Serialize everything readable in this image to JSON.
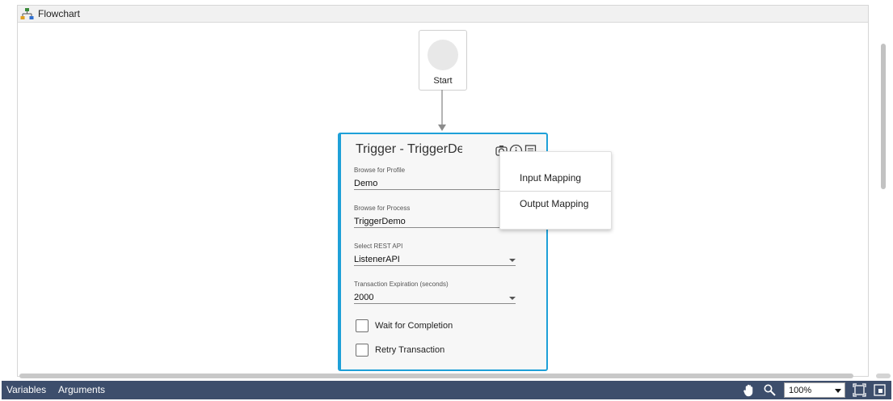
{
  "header": {
    "title": "Flowchart"
  },
  "start_node": {
    "label": "Start"
  },
  "trigger": {
    "title": "Trigger - TriggerDemo",
    "fields": [
      {
        "label": "Browse for Profile",
        "value": "Demo",
        "dropdown": false
      },
      {
        "label": "Browse for Process",
        "value": "TriggerDemo",
        "dropdown": false
      },
      {
        "label": "Select REST API",
        "value": "ListenerAPI",
        "dropdown": true
      },
      {
        "label": "Transaction Expiration (seconds)",
        "value": "2000",
        "dropdown": true
      }
    ],
    "checkboxes": [
      {
        "label": "Wait for Completion",
        "checked": false
      },
      {
        "label": "Retry Transaction",
        "checked": false
      }
    ],
    "icons": [
      "camera-icon",
      "info-icon",
      "notes-icon"
    ]
  },
  "context_menu": {
    "items": [
      "Input Mapping",
      "Output Mapping"
    ]
  },
  "bottom_bar": {
    "tabs": [
      "Variables",
      "Arguments"
    ],
    "zoom": "100%",
    "tools": [
      "hand-pan-icon",
      "search-icon",
      "fit-to-screen-icon",
      "overview-icon"
    ]
  },
  "colors": {
    "accent": "#1ea0d8",
    "bottom_bar": "#3d4e6c"
  }
}
